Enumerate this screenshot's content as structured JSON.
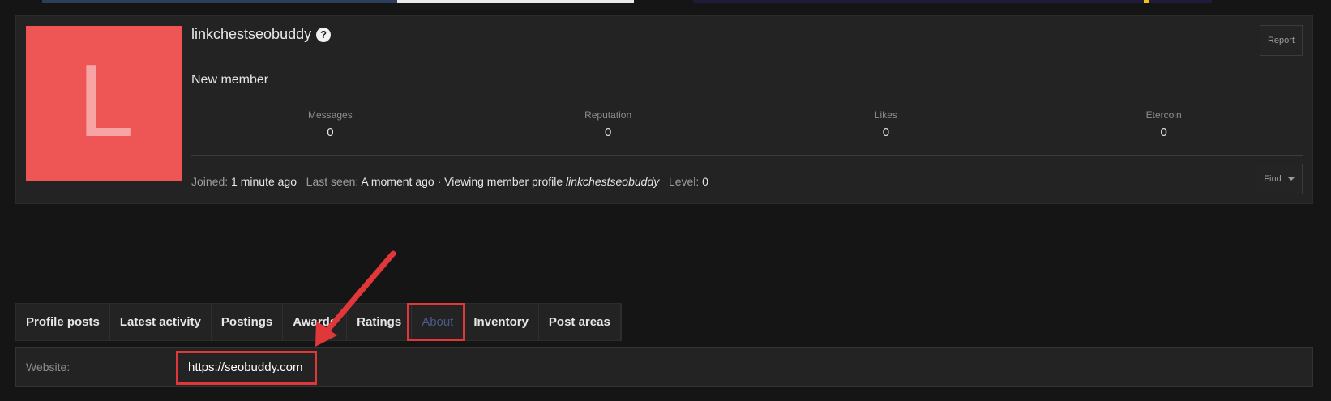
{
  "profile": {
    "avatar_letter": "L",
    "username": "linkchestseobuddy",
    "member_title": "New member",
    "report_label": "Report",
    "stats": [
      {
        "label": "Messages",
        "value": "0"
      },
      {
        "label": "Reputation",
        "value": "0"
      },
      {
        "label": "Likes",
        "value": "0"
      },
      {
        "label": "Etercoin",
        "value": "0"
      }
    ],
    "meta": {
      "joined_label": "Joined:",
      "joined_value": "1 minute ago",
      "last_seen_label": "Last seen:",
      "last_seen_value": "A moment ago · Viewing member profile",
      "last_seen_target": "linkchestseobuddy",
      "level_label": "Level:",
      "level_value": "0"
    },
    "find_label": "Find"
  },
  "tabs": [
    {
      "label": "Profile posts"
    },
    {
      "label": "Latest activity"
    },
    {
      "label": "Postings"
    },
    {
      "label": "Awards"
    },
    {
      "label": "Ratings"
    },
    {
      "label": "About"
    },
    {
      "label": "Inventory"
    },
    {
      "label": "Post areas"
    }
  ],
  "active_tab": "About",
  "about": {
    "website_label": "Website:",
    "website_value": "https://seobuddy.com"
  },
  "colors": {
    "avatar_bg": "#ee5655",
    "annotation": "#e0373a",
    "active_tab": "#4c5a8a"
  }
}
